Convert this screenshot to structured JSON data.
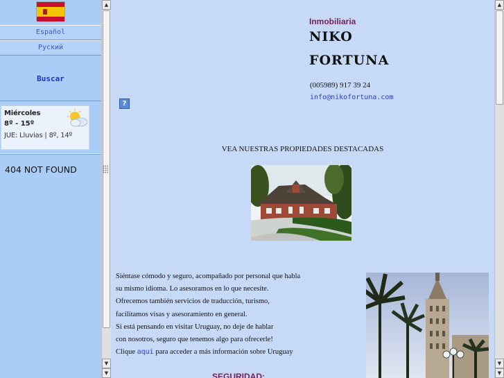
{
  "sidebar": {
    "flag": "spain-flag",
    "languages": [
      {
        "label": "Español"
      },
      {
        "label": "Руский"
      }
    ],
    "search_label": "Buscar",
    "weather": {
      "day": "Miércoles",
      "temp": "8º - 15º",
      "next": "JUE: Lluvias | 8º, 14º",
      "icon": "partly-cloudy-icon"
    },
    "not_found": "404 NOT FOUND"
  },
  "main": {
    "brand_sub": "Inmobiliaria",
    "brand_line1": "NIKO",
    "brand_line2": "FORTUNA",
    "phone": "(005989) 917 39 24",
    "email": "info@nikofortuna.com",
    "help_icon": "?",
    "featured_heading": "VEA NUESTRAS PROPIEDADES DESTACADAS",
    "paragraph": [
      "Siéntase cómodo y seguro, acompañado por personal que habla",
      "su mismo idioma. Lo asesoramos en lo que necesite.",
      "Ofrecemos también servicios de traducción, turismo,",
      "facilitamos visas y asesoramiento en general.",
      "Si está pensando en visitar Uruguay, no deje de hablar",
      "con nosotros, seguro que tenemos algo para ofrecerle!"
    ],
    "last_line": {
      "before": "Clique ",
      "link": "aqui",
      "after": " para acceder a más información sobre Uruguay"
    },
    "security_heading": "SEGURIDAD:"
  },
  "colors": {
    "sidebar_bg": "#a9cdf6",
    "main_bg": "#c6d9f7",
    "link": "#2b3fc4",
    "accent": "#7a1e57"
  }
}
